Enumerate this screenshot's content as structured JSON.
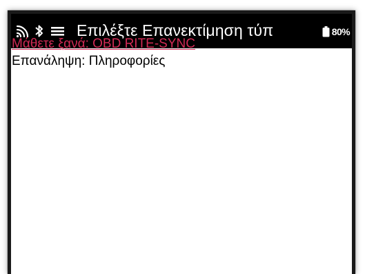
{
  "header": {
    "title": "Επιλέξτε Επανεκτίμηση τύπ",
    "battery_level": "80%",
    "icons": [
      "signal-icon",
      "bluetooth-icon",
      "menu-icon",
      "battery-icon"
    ]
  },
  "menu": {
    "items": [
      {
        "label": "Μάθετε ξανά: OBD RITE-SYNC",
        "selected": true
      },
      {
        "label": "Επανάληψη: Πληροφορίες",
        "selected": false
      }
    ]
  },
  "colors": {
    "statusbar_bg": "#000000",
    "selected_item": "#d22a55",
    "text": "#000000",
    "background": "#ffffff"
  }
}
